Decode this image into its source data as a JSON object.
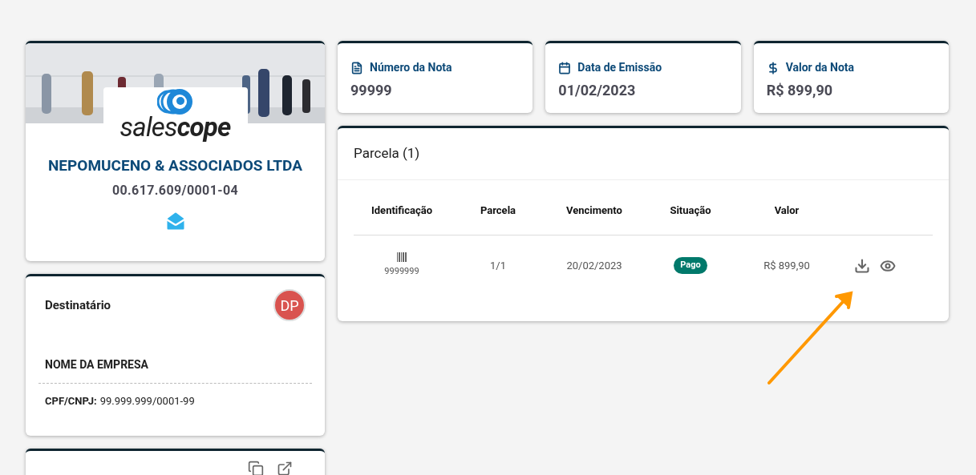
{
  "company": {
    "logo_text": [
      "sales",
      "cope"
    ],
    "name": "NEPOMUCENO & ASSOCIADOS LTDA",
    "cnpj": "00.617.609/0001-04"
  },
  "recipient": {
    "title": "Destinatário",
    "avatar": {
      "initials": "DP",
      "color": "#d9534f"
    },
    "company_name": "NOME DA EMPRESA",
    "doc_label": "CPF/CNPJ:",
    "doc_value": "99.999.999/0001-99"
  },
  "summary": [
    {
      "kind": "file",
      "label": "Número da Nota",
      "value": "99999"
    },
    {
      "kind": "calendar",
      "label": "Data de Emissão",
      "value": "01/02/2023"
    },
    {
      "kind": "money",
      "label": "Valor da Nota",
      "value": "R$ 899,90"
    }
  ],
  "installments": {
    "title": "Parcela (1)",
    "columns": [
      "Identificação",
      "Parcela",
      "Vencimento",
      "Situação",
      "Valor"
    ],
    "rows": [
      {
        "id": "9999999",
        "installment": "1/1",
        "due": "20/02/2023",
        "status": "Pago",
        "color": "#00796b",
        "value": "R$ 899,90"
      }
    ]
  },
  "annotation": {
    "color": "#ff9800"
  }
}
